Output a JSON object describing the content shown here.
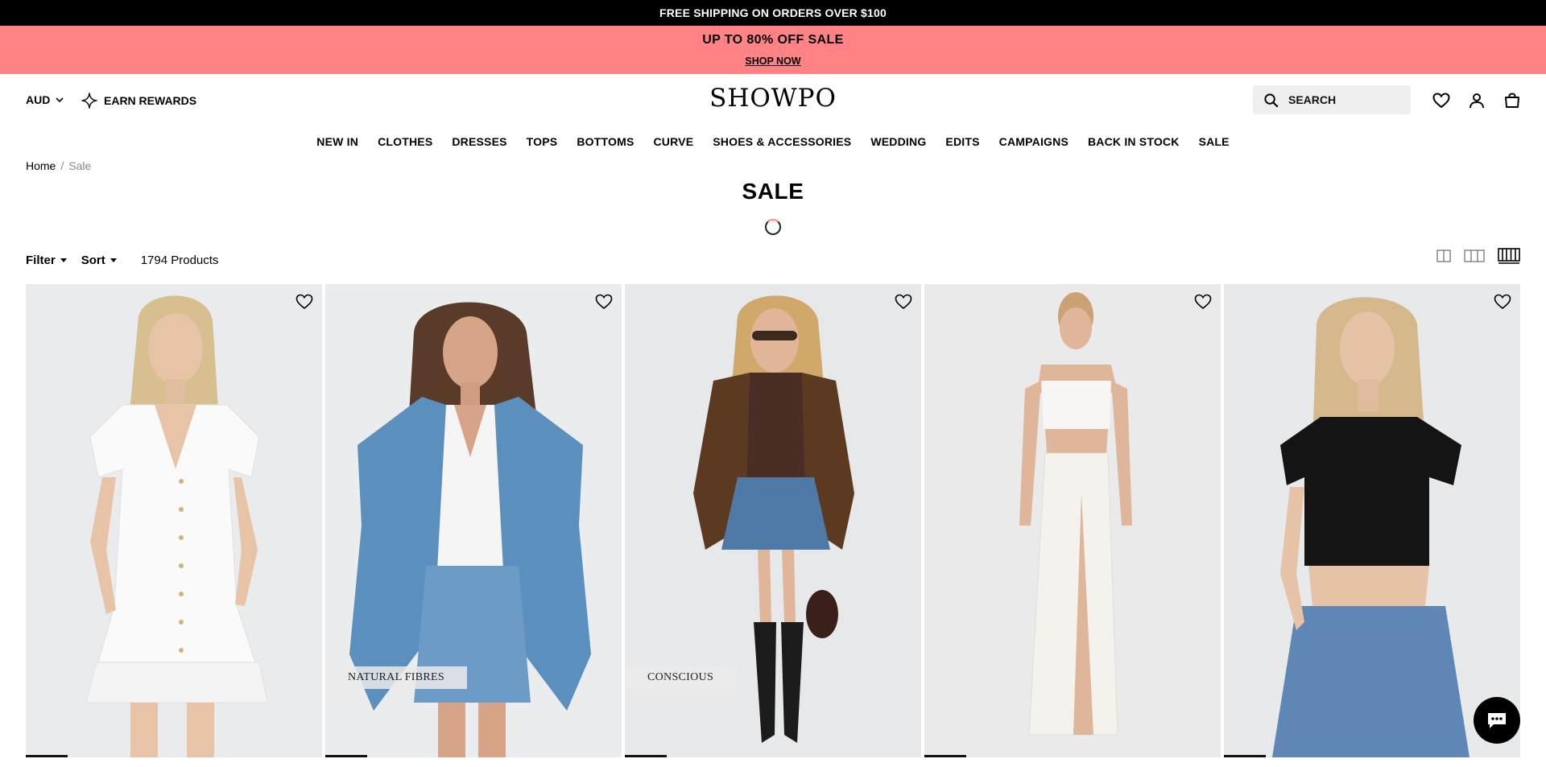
{
  "announcement": {
    "text": "FREE SHIPPING ON ORDERS OVER $100"
  },
  "banner": {
    "headline": "UP TO 80% OFF SALE",
    "cta": "SHOP NOW",
    "background": "#ff8285"
  },
  "header": {
    "currency": "AUD",
    "rewards_label": "EARN REWARDS",
    "logo": "SHOWPO",
    "search_placeholder": "SEARCH"
  },
  "nav": [
    "NEW IN",
    "CLOTHES",
    "DRESSES",
    "TOPS",
    "BOTTOMS",
    "CURVE",
    "SHOES & ACCESSORIES",
    "WEDDING",
    "EDITS",
    "CAMPAIGNS",
    "BACK IN STOCK",
    "SALE"
  ],
  "breadcrumb": {
    "home": "Home",
    "separator": "/",
    "current": "Sale"
  },
  "page_title": "SALE",
  "toolbar": {
    "filter": "Filter",
    "sort": "Sort",
    "count": "1794 Products"
  },
  "products": [
    {
      "tag": "",
      "image": "white-knit-mini-dress"
    },
    {
      "tag": "NATURAL FIBRES",
      "image": "denim-blazer-and-skirt"
    },
    {
      "tag": "CONSCIOUS",
      "image": "leather-jacket-denim-skirt"
    },
    {
      "tag": "",
      "image": "white-crop-top-maxi-skirt"
    },
    {
      "tag": "",
      "image": "black-crop-tee-jeans"
    }
  ]
}
